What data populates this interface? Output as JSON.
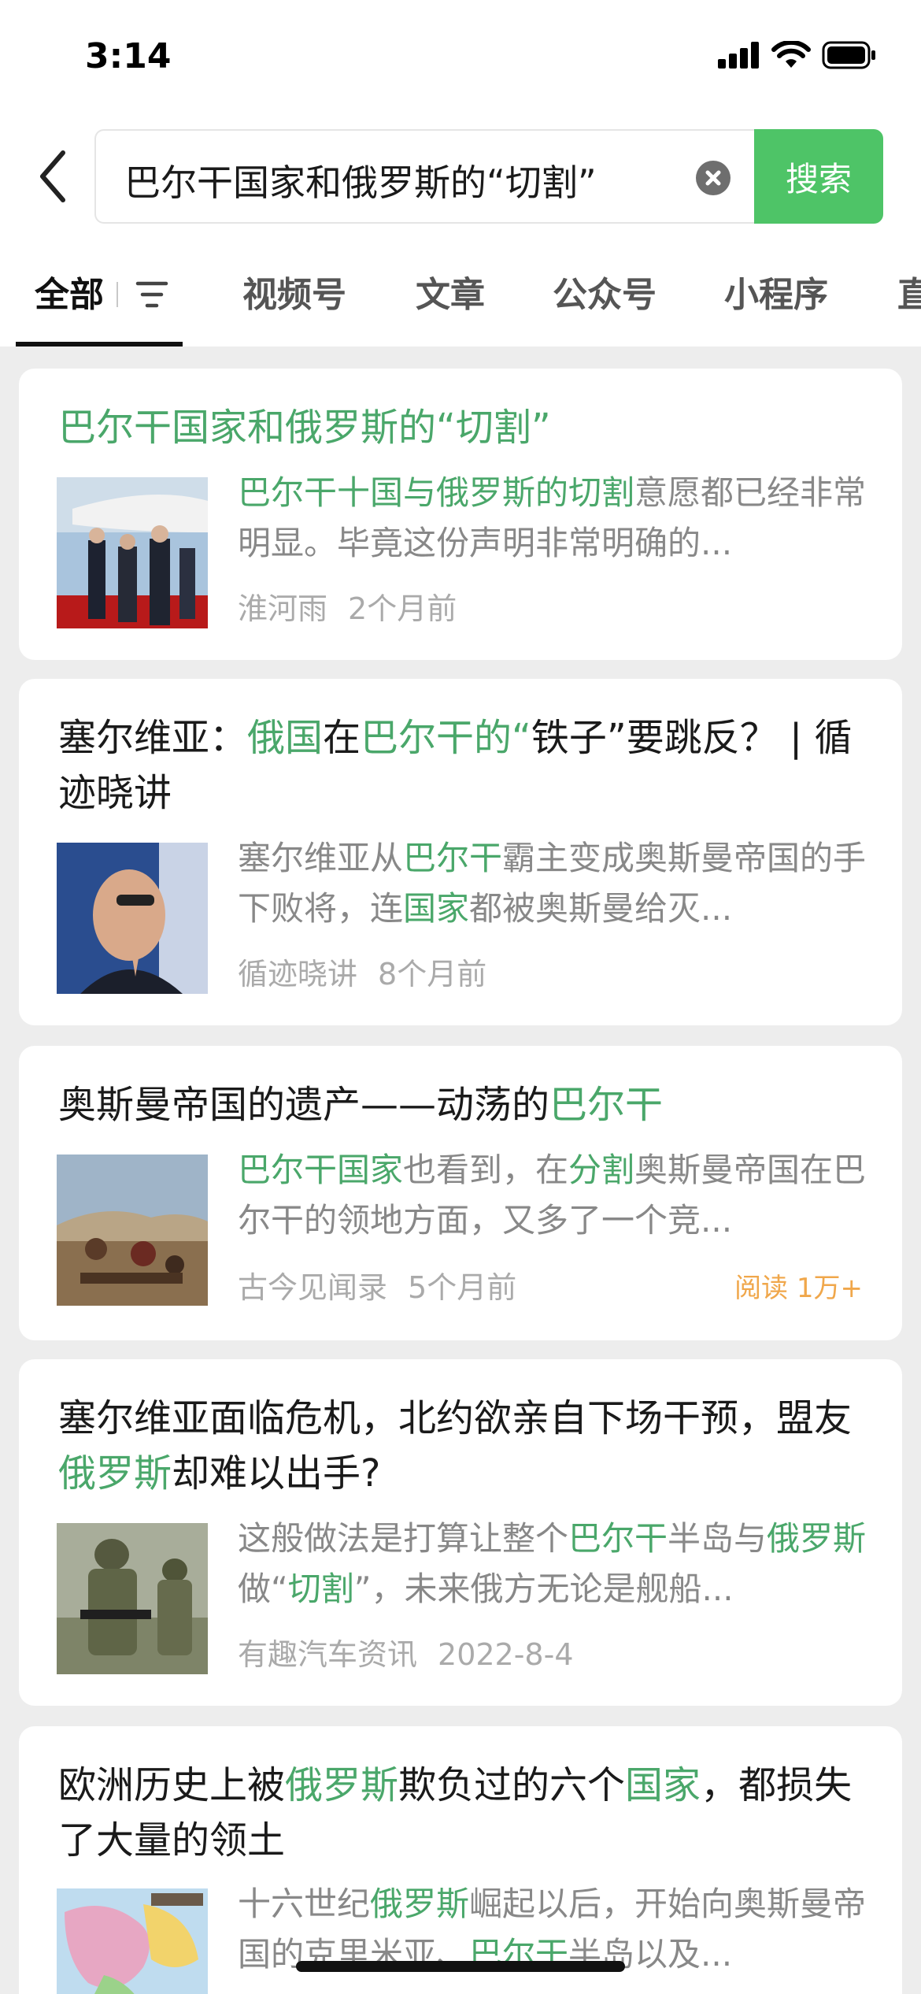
{
  "status_bar": {
    "time": "3:14"
  },
  "search": {
    "query": "巴尔干国家和俄罗斯的“切割”",
    "button_label": "搜索"
  },
  "tabs": [
    "全部",
    "视频号",
    "文章",
    "公众号",
    "小程序",
    "直"
  ],
  "results": [
    {
      "title": "巴尔干国家和俄罗斯的“切割”",
      "snippet_parts": [
        [
          "巴尔干十国与俄罗斯的切割",
          true
        ],
        [
          "意愿都已经非常明显。毕竟这份声明非常明确的...",
          false
        ]
      ],
      "source": "淮河雨",
      "time": "2个月前",
      "reads": ""
    },
    {
      "title_parts": [
        [
          "塞尔维亚：",
          false
        ],
        [
          "俄国",
          true
        ],
        [
          "在",
          false
        ],
        [
          "巴尔干的“",
          true
        ],
        [
          "铁子”要跳反？ | 循迹晓讲",
          false
        ]
      ],
      "snippet_parts": [
        [
          "塞尔维亚从",
          false
        ],
        [
          "巴尔干",
          true
        ],
        [
          "霸主变成奥斯曼帝国的手下败将，连",
          false
        ],
        [
          "国家",
          true
        ],
        [
          "都被奥斯曼给灭...",
          false
        ]
      ],
      "source": "循迹晓讲",
      "time": "8个月前",
      "reads": ""
    },
    {
      "title_parts": [
        [
          "奥斯曼帝国的遗产——动荡的",
          false
        ],
        [
          "巴尔干",
          true
        ]
      ],
      "snippet_parts": [
        [
          "巴尔干国家",
          true
        ],
        [
          "也看到，在",
          false
        ],
        [
          "分割",
          true
        ],
        [
          "奥斯曼帝国在巴尔干的领地方面，又多了一个竞...",
          false
        ]
      ],
      "source": "古今见闻录",
      "time": "5个月前",
      "reads": "阅读 1万+"
    },
    {
      "title_parts": [
        [
          "塞尔维亚面临危机，北约欲亲自下场干预，盟友",
          false
        ],
        [
          "俄罗斯",
          true
        ],
        [
          "却难以出手?",
          false
        ]
      ],
      "snippet_parts": [
        [
          "这般做法是打算让整个",
          false
        ],
        [
          "巴尔干",
          true
        ],
        [
          "半岛与",
          false
        ],
        [
          "俄罗斯",
          true
        ],
        [
          "做“",
          false
        ],
        [
          "切割",
          true
        ],
        [
          "”，未来俄方无论是舰船...",
          false
        ]
      ],
      "source": "有趣汽车资讯",
      "time": "2022-8-4",
      "reads": ""
    },
    {
      "title_parts": [
        [
          "欧洲历史上被",
          false
        ],
        [
          "俄罗斯",
          true
        ],
        [
          "欺负过的六个",
          false
        ],
        [
          "国家",
          true
        ],
        [
          "，都损失了大量的领土",
          false
        ]
      ],
      "snippet_parts": [
        [
          "十六世纪",
          false
        ],
        [
          "俄罗斯",
          true
        ],
        [
          "崛起以后，开始向奥斯曼帝国的克里米亚、",
          false
        ],
        [
          "巴尔干",
          true
        ],
        [
          "半岛以及...",
          false
        ]
      ],
      "source": "",
      "time": "",
      "reads": ""
    }
  ],
  "colors": {
    "accent_green": "#4ec467",
    "highlight_green": "#4aa76a",
    "reads_orange": "#f0a74b"
  }
}
